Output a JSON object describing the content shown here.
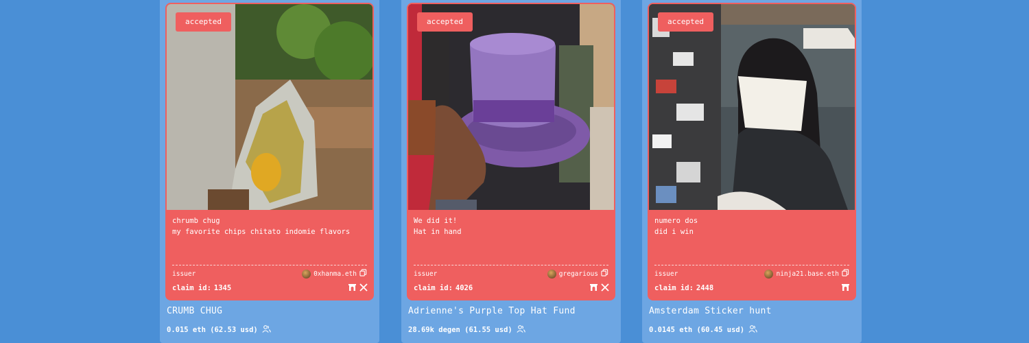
{
  "cards": [
    {
      "status": "accepted",
      "description_line1": "chrumb chug",
      "description_line2": "my favorite chips chitato indomie flavors",
      "issuer_label": "issuer",
      "issuer_name": "0xhanma.eth",
      "claim_label": "claim id:",
      "claim_id": "1345",
      "title": "CRUMB CHUG",
      "price": "0.015 eth (62.53 usd)",
      "socials": [
        "farcaster-icon",
        "x-icon"
      ]
    },
    {
      "status": "accepted",
      "description_line1": "We did it!",
      "description_line2": "Hat in hand",
      "issuer_label": "issuer",
      "issuer_name": "gregarious",
      "claim_label": "claim id:",
      "claim_id": "4026",
      "title": "Adrienne's Purple Top Hat Fund",
      "price": "28.69k degen (61.55 usd)",
      "socials": [
        "farcaster-icon",
        "x-icon"
      ]
    },
    {
      "status": "accepted",
      "description_line1": "numero dos",
      "description_line2": "did i win",
      "issuer_label": "issuer",
      "issuer_name": "ninja21.base.eth",
      "claim_label": "claim id:",
      "claim_id": "2448",
      "title": "Amsterdam Sticker hunt",
      "price": "0.0145 eth (60.45 usd)",
      "socials": [
        "farcaster-icon"
      ]
    }
  ],
  "colors": {
    "background": "#4a8fd6",
    "card": "#6da6e3",
    "accent": "#ef5f5f"
  }
}
